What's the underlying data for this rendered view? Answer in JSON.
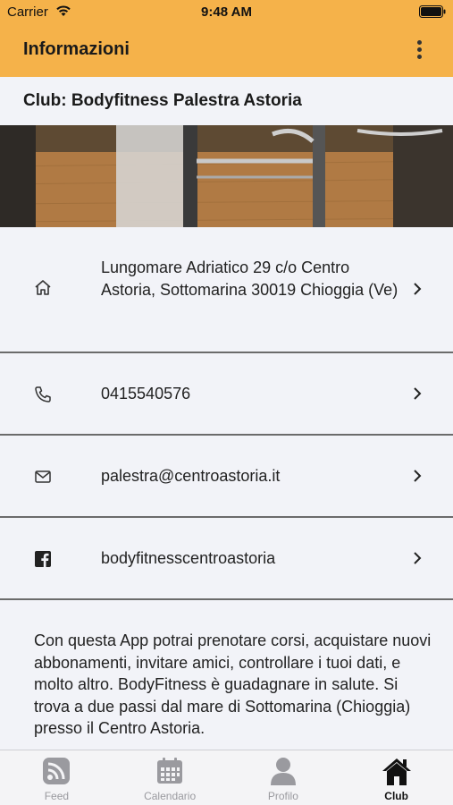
{
  "status_bar": {
    "carrier": "Carrier",
    "time": "9:48 AM"
  },
  "header": {
    "title": "Informazioni",
    "menu_icon": "kebab-menu-icon"
  },
  "club": {
    "title": "Club: Bodyfitness Palestra Astoria"
  },
  "contacts": [
    {
      "icon": "home-icon",
      "text": "Lungomare Adriatico 29 c/o Centro Astoria, Sottomarina 30019 Chioggia (Ve)"
    },
    {
      "icon": "phone-icon",
      "text": "0415540576"
    },
    {
      "icon": "mail-icon",
      "text": "palestra@centroastoria.it"
    },
    {
      "icon": "facebook-icon",
      "text": "bodyfitnesscentroastoria"
    }
  ],
  "description": "Con questa App potrai prenotare corsi, acquistare nuovi abbonamenti, invitare amici, controllare i tuoi dati, e molto altro. BodyFitness è guadagnare in salute. Si trova a due passi dal mare di Sottomarina (Chioggia) presso il Centro Astoria.",
  "tabs": [
    {
      "label": "Feed",
      "icon": "rss-feed-icon",
      "active": false
    },
    {
      "label": "Calendario",
      "icon": "calendar-icon",
      "active": false
    },
    {
      "label": "Profilo",
      "icon": "user-icon",
      "active": false
    },
    {
      "label": "Club",
      "icon": "home-icon",
      "active": true
    }
  ],
  "colors": {
    "header_bg": "#f5b24a",
    "background": "#f2f3f8",
    "tab_inactive": "#9a9a9f",
    "tab_active": "#111111"
  }
}
